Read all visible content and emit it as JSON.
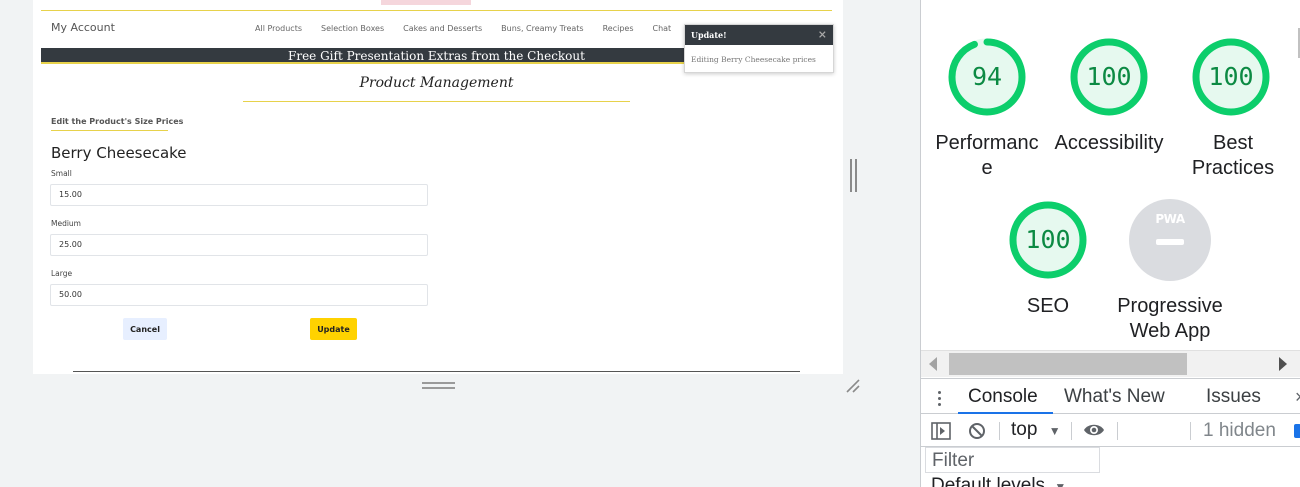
{
  "site": {
    "account_link": "My Account",
    "nav": [
      "All Products",
      "Selection Boxes",
      "Cakes and Desserts",
      "Buns, Creamy Treats",
      "Recipes",
      "Chat"
    ],
    "banner": "Free Gift Presentation Extras from the Checkout",
    "page_title": "Product Management",
    "section_label": "Edit the Product's Size Prices",
    "product_name": "Berry Cheesecake",
    "fields": [
      {
        "label": "Small",
        "value": "15.00"
      },
      {
        "label": "Medium",
        "value": "25.00"
      },
      {
        "label": "Large",
        "value": "50.00"
      }
    ],
    "cancel_label": "Cancel",
    "update_label": "Update"
  },
  "toast": {
    "title": "Update!",
    "close": "×",
    "message": "Editing Berry Cheesecake prices"
  },
  "lighthouse": {
    "scores": [
      {
        "name": "Performance",
        "value": "94",
        "score": 0.94
      },
      {
        "name": "Accessibility",
        "value": "100",
        "score": 1.0
      },
      {
        "name": "Best Practices",
        "value": "100",
        "score": 1.0
      },
      {
        "name": "SEO",
        "value": "100",
        "score": 1.0
      }
    ],
    "pwa": {
      "badge": "PWA",
      "label": "Progressive Web App"
    },
    "pass_color": "#0cce6b",
    "pass_text_color": "#0c8a43"
  },
  "drawer": {
    "tabs": [
      "Console",
      "What's New",
      "Issues"
    ],
    "active_tab": "Console",
    "close": "×"
  },
  "console": {
    "context": "top",
    "hidden": "1 hidden",
    "filter_placeholder": "Filter",
    "levels": "Default levels"
  },
  "icons": {
    "sidebar": "sidebar-toggle-icon",
    "clear": "clear-console-icon",
    "eye": "live-expression-eye-icon",
    "kebab": "more-tabs-icon"
  }
}
